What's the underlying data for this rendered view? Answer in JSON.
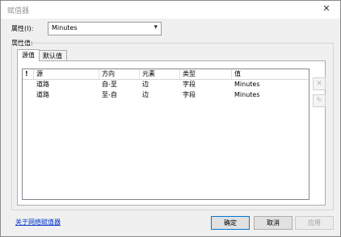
{
  "window": {
    "title": "赋值器"
  },
  "attribute": {
    "label": "属性(I):",
    "selected": "Minutes"
  },
  "group": {
    "label": "属性值:"
  },
  "tabs": [
    {
      "label": "源值",
      "active": true
    },
    {
      "label": "默认值",
      "active": false
    }
  ],
  "table": {
    "columns": [
      "!",
      "源",
      "方向",
      "元素",
      "类型",
      "值"
    ],
    "rows": [
      [
        "",
        "道路",
        "自-至",
        "边",
        "字段",
        "Minutes"
      ],
      [
        "",
        "道路",
        "至-自",
        "边",
        "字段",
        "Minutes"
      ]
    ]
  },
  "footer": {
    "link": "关于网络赋值器",
    "ok": "确定",
    "cancel": "取消",
    "apply": "应用"
  },
  "icons": {
    "close": "close-icon",
    "dropdown": "chevron-down-icon",
    "delete": "delete-x-icon",
    "edit": "edit-icon"
  }
}
